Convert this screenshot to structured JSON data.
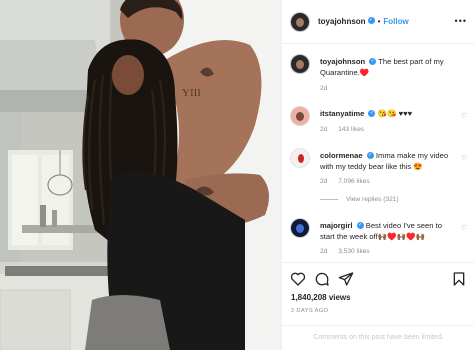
{
  "post": {
    "username": "toyajohnson",
    "follow_label": "Follow",
    "separator": "•",
    "more_label": "•••"
  },
  "caption": {
    "username": "toyajohnson",
    "text": "The best part of my Quarantine.",
    "emoji": "♥️",
    "time": "2d"
  },
  "comments": [
    {
      "username": "itstanyatime",
      "text": "😘😘 ♥♥♥",
      "time": "2d",
      "likes": "143 likes"
    },
    {
      "username": "colormenae",
      "text": "Imma make my video with my teddy bear like this 😍",
      "time": "2d",
      "likes": "7,096 likes",
      "view_replies": "View replies (321)"
    },
    {
      "username": "majorgirl",
      "text": "Best video I've seen to start the week off🙌🏾♥️🙌🏾♥️🙌🏾",
      "time": "2d",
      "likes": "3,530 likes"
    }
  ],
  "stats": {
    "views": "1,840,208 views",
    "date": "2 DAYS AGO"
  },
  "notice": "Comments on this post have been limited.",
  "icons": {
    "like": "heart-icon",
    "comment": "comment-icon",
    "share": "share-icon",
    "save": "bookmark-icon"
  },
  "colors": {
    "link": "#3897f0",
    "muted": "#8e8e8e",
    "heart_red": "#ed4956"
  }
}
